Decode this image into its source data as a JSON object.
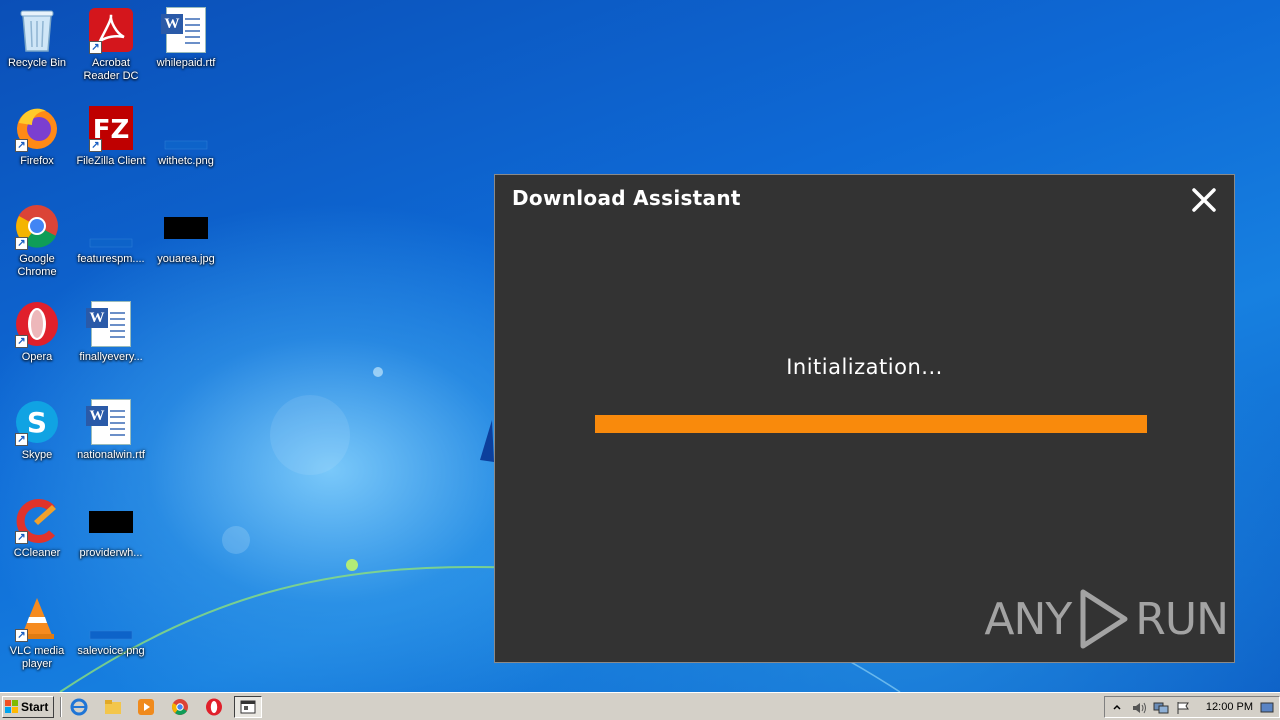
{
  "desktop": {
    "icons": [
      {
        "label": "Recycle Bin"
      },
      {
        "label": "Acrobat Reader DC"
      },
      {
        "label": "whilepaid.rtf"
      },
      {
        "label": "Firefox"
      },
      {
        "label": "FileZilla Client"
      },
      {
        "label": "withetc.png"
      },
      {
        "label": "Google Chrome"
      },
      {
        "label": "featurespm...."
      },
      {
        "label": "youarea.jpg"
      },
      {
        "label": "Opera"
      },
      {
        "label": "finallyevery..."
      },
      {
        "label": "Skype"
      },
      {
        "label": "nationalwin.rtf"
      },
      {
        "label": "CCleaner"
      },
      {
        "label": "providerwh..."
      },
      {
        "label": "VLC media player"
      },
      {
        "label": "salevoice.png"
      }
    ]
  },
  "dialog": {
    "title": "Download Assistant",
    "status": "Initialization...",
    "progress_fraction": 1.0,
    "progress_color": "#f98a0c",
    "background": "#333333"
  },
  "watermark": {
    "left": "ANY",
    "right": "RUN"
  },
  "taskbar": {
    "start_label": "Start",
    "clock": "12:00 PM",
    "pinned_icons": [
      "ie-icon",
      "explorer-icon",
      "media-player-icon",
      "chrome-icon",
      "opera-icon",
      "active-window-icon"
    ]
  }
}
